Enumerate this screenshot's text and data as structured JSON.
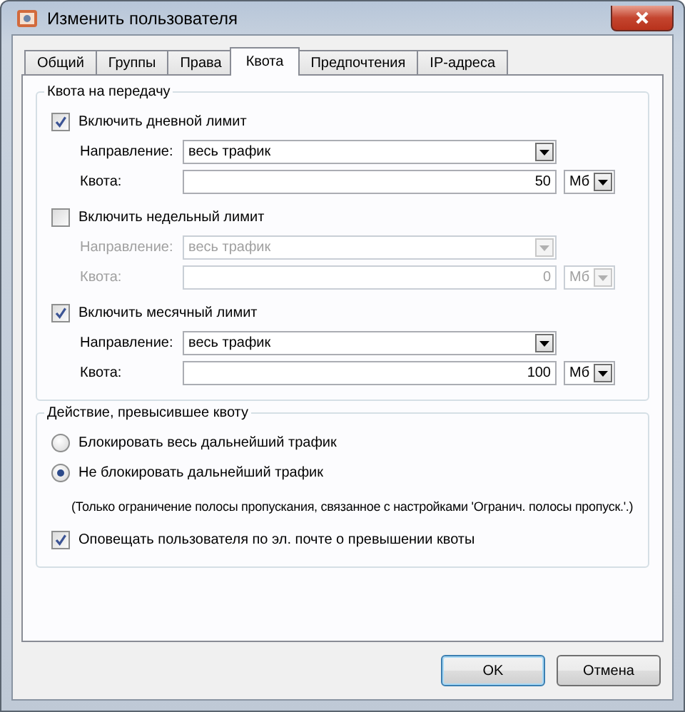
{
  "window": {
    "title": "Изменить пользователя"
  },
  "tabs": [
    {
      "label": "Общий",
      "selected": false
    },
    {
      "label": "Группы",
      "selected": false
    },
    {
      "label": "Права",
      "selected": false
    },
    {
      "label": "Квота",
      "selected": true
    },
    {
      "label": "Предпочтения",
      "selected": false
    },
    {
      "label": "IP-адреса",
      "selected": false
    }
  ],
  "quota_group": {
    "title": "Квота на передачу",
    "limits": [
      {
        "label": "Включить дневной лимит",
        "checked": true,
        "direction_label": "Направление:",
        "direction": "весь трафик",
        "quota_label": "Квота:",
        "quota": "50",
        "unit": "Мб"
      },
      {
        "label": "Включить недельный лимит",
        "checked": false,
        "direction_label": "Направление:",
        "direction": "весь трафик",
        "quota_label": "Квота:",
        "quota": "0",
        "unit": "Мб"
      },
      {
        "label": "Включить месячный лимит",
        "checked": true,
        "direction_label": "Направление:",
        "direction": "весь трафик",
        "quota_label": "Квота:",
        "quota": "100",
        "unit": "Мб"
      }
    ]
  },
  "action_group": {
    "title": "Действие, превысившее квоту",
    "options": [
      {
        "label": "Блокировать весь дальнейший трафик",
        "selected": false
      },
      {
        "label": "Не блокировать дальнейший трафик",
        "selected": true
      }
    ],
    "note": "(Только ограничение полосы пропускания, связанное с настройками 'Огранич. полосы пропуск.'.)",
    "notify": {
      "label": "Оповещать пользователя по эл. почте о превышении квоты",
      "checked": true
    }
  },
  "buttons": [
    {
      "label": "OK",
      "default": true
    },
    {
      "label": "Отмена",
      "default": false
    }
  ]
}
